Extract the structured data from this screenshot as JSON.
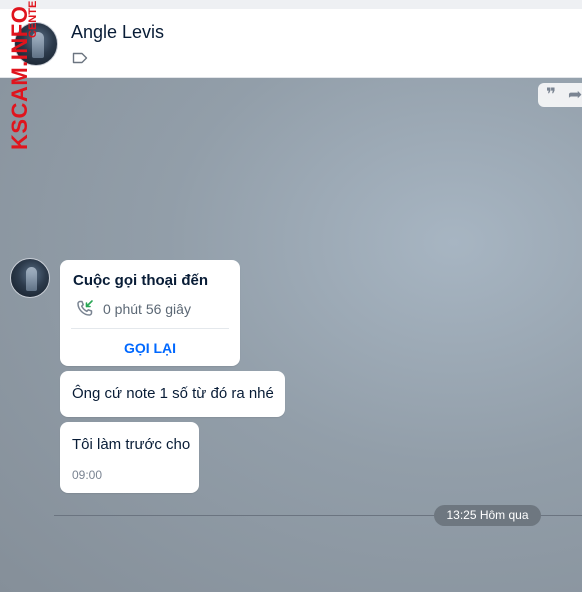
{
  "header": {
    "contact_name": "Angle Levis",
    "avatar_icon": "user-avatar",
    "tag_icon": "tag-icon"
  },
  "watermark": {
    "main_text": "KSCAM.INFO",
    "sub_text": "CENTER"
  },
  "toolbar": {
    "quote_icon": "quote-icon",
    "forward_icon": "share-icon"
  },
  "messages": {
    "call": {
      "title": "Cuộc gọi thoại đến",
      "duration": "0 phút 56 giây",
      "action": "GỌI LẠI",
      "icon": "incoming-call-icon",
      "icon_color": "#29a655",
      "action_color": "#0068ff"
    },
    "text1": "Ông cứ note 1 số từ đó ra nhé",
    "text2": "Tôi làm trước cho",
    "text2_time": "09:00"
  },
  "timeline": {
    "separator_label": "13:25 Hôm qua"
  },
  "colors": {
    "watermark": "#e0141d",
    "name": "#081c36"
  }
}
